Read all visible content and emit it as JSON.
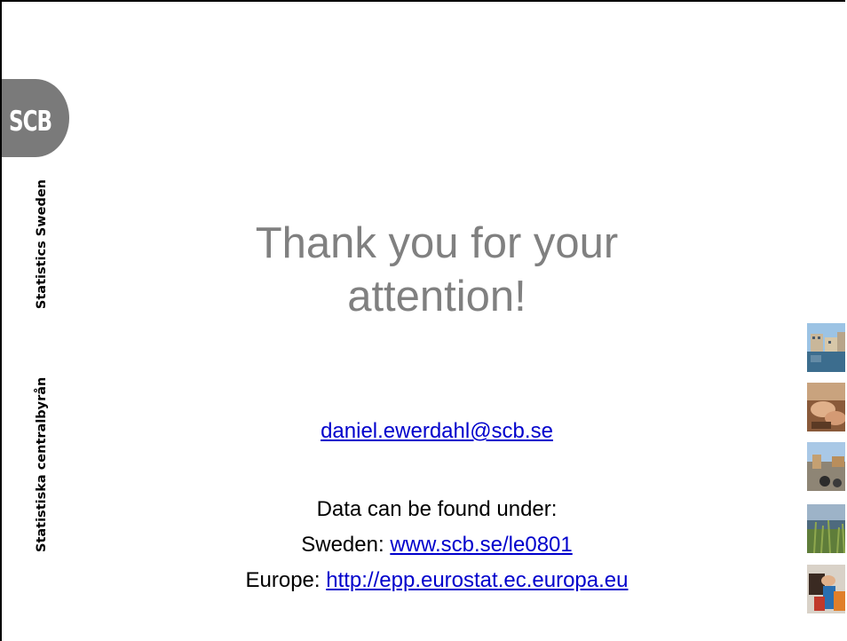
{
  "logo": {
    "text": "SCB"
  },
  "sidebar": {
    "name_sv": "Statistiska centralbyrån",
    "name_en": "Statistics Sweden"
  },
  "title": {
    "line1": "Thank you for your",
    "line2": "attention!"
  },
  "contact": {
    "email": "daniel.ewerdahl@scb.se"
  },
  "data_sources": {
    "intro": "Data can be found under:",
    "sweden_label": "Sweden: ",
    "sweden_link": "www.scb.se/le0801",
    "europe_label": "Europe: ",
    "europe_link": "http://epp.eurostat.ec.europa.eu"
  },
  "colors": {
    "title": "#808080",
    "link": "#0000cc",
    "logo": "#7a7a7a"
  },
  "thumbnails": [
    "waterfront-photo",
    "hands-photo",
    "playground-photo",
    "lake-reeds-photo",
    "shopping-bags-photo"
  ]
}
